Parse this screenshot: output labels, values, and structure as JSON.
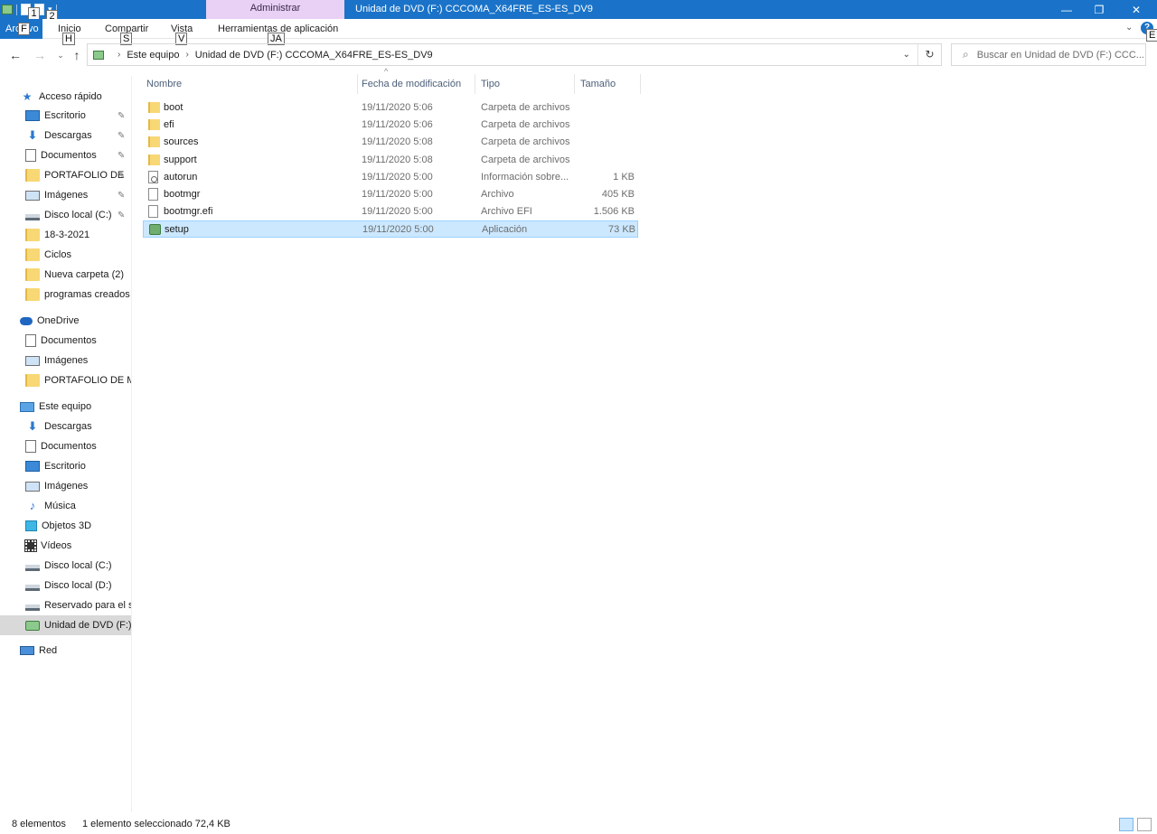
{
  "window": {
    "title": "Unidad de DVD (F:) CCCOMA_X64FRE_ES-ES_DV9",
    "context_tab": "Administrar",
    "controls": {
      "minimize": "—",
      "restore": "❐",
      "close": "✕"
    }
  },
  "quick_access_keytips": [
    "1",
    "2"
  ],
  "ribbon": {
    "tabs": [
      {
        "label": "Archivo",
        "keytip": "F"
      },
      {
        "label": "Inicio",
        "keytip": "H"
      },
      {
        "label": "Compartir",
        "keytip": "S"
      },
      {
        "label": "Vista",
        "keytip": "V"
      },
      {
        "label": "Herramientas de aplicación",
        "keytip": "JA"
      }
    ],
    "help_keytip": "E"
  },
  "address": {
    "crumbs": [
      "Este equipo",
      "Unidad de DVD (F:) CCCOMA_X64FRE_ES-ES_DV9"
    ],
    "search_placeholder": "Buscar en Unidad de DVD (F:) CCC..."
  },
  "nav": {
    "quick_access": {
      "label": "Acceso rápido"
    },
    "quick_items": [
      {
        "label": "Escritorio",
        "icon": "desktop-icon",
        "pinned": true
      },
      {
        "label": "Descargas",
        "icon": "download-icon",
        "pinned": true
      },
      {
        "label": "Documentos",
        "icon": "document-icon",
        "pinned": true
      },
      {
        "label": "PORTAFOLIO DE",
        "icon": "folder-icon",
        "pinned": true
      },
      {
        "label": "Imágenes",
        "icon": "pictures-icon",
        "pinned": true
      },
      {
        "label": "Disco local (C:)",
        "icon": "drive-icon",
        "pinned": true
      },
      {
        "label": "18-3-2021",
        "icon": "folder-icon",
        "pinned": false
      },
      {
        "label": "Ciclos",
        "icon": "folder-icon",
        "pinned": false
      },
      {
        "label": "Nueva carpeta (2)",
        "icon": "folder-icon",
        "pinned": false
      },
      {
        "label": "programas creados",
        "icon": "folder-icon",
        "pinned": false
      }
    ],
    "onedrive": {
      "label": "OneDrive"
    },
    "onedrive_items": [
      {
        "label": "Documentos",
        "icon": "document-icon"
      },
      {
        "label": "Imágenes",
        "icon": "pictures-icon"
      },
      {
        "label": "PORTAFOLIO DE MA",
        "icon": "folder-icon"
      }
    ],
    "this_pc": {
      "label": "Este equipo"
    },
    "pc_items": [
      {
        "label": "Descargas",
        "icon": "download-icon"
      },
      {
        "label": "Documentos",
        "icon": "document-icon"
      },
      {
        "label": "Escritorio",
        "icon": "desktop-icon"
      },
      {
        "label": "Imágenes",
        "icon": "pictures-icon"
      },
      {
        "label": "Música",
        "icon": "music-icon"
      },
      {
        "label": "Objetos 3D",
        "icon": "3d-objects-icon"
      },
      {
        "label": "Vídeos",
        "icon": "video-icon"
      },
      {
        "label": "Disco local (C:)",
        "icon": "drive-icon"
      },
      {
        "label": "Disco local (D:)",
        "icon": "drive-icon"
      },
      {
        "label": "Reservado para el si",
        "icon": "drive-icon"
      },
      {
        "label": "Unidad de DVD (F:)",
        "icon": "dvd-drive-icon",
        "selected": true
      }
    ],
    "network": {
      "label": "Red"
    }
  },
  "filelist": {
    "columns": [
      "Nombre",
      "Fecha de modificación",
      "Tipo",
      "Tamaño"
    ],
    "rows": [
      {
        "name": "boot",
        "date": "19/11/2020 5:06",
        "type": "Carpeta de archivos",
        "size": "",
        "icon": "folder-icon"
      },
      {
        "name": "efi",
        "date": "19/11/2020 5:06",
        "type": "Carpeta de archivos",
        "size": "",
        "icon": "folder-icon"
      },
      {
        "name": "sources",
        "date": "19/11/2020 5:08",
        "type": "Carpeta de archivos",
        "size": "",
        "icon": "folder-icon"
      },
      {
        "name": "support",
        "date": "19/11/2020 5:08",
        "type": "Carpeta de archivos",
        "size": "",
        "icon": "folder-icon"
      },
      {
        "name": "autorun",
        "date": "19/11/2020 5:00",
        "type": "Información sobre...",
        "size": "1 KB",
        "icon": "settings-file-icon"
      },
      {
        "name": "bootmgr",
        "date": "19/11/2020 5:00",
        "type": "Archivo",
        "size": "405 KB",
        "icon": "file-icon"
      },
      {
        "name": "bootmgr.efi",
        "date": "19/11/2020 5:00",
        "type": "Archivo EFI",
        "size": "1.506 KB",
        "icon": "file-icon"
      },
      {
        "name": "setup",
        "date": "19/11/2020 5:00",
        "type": "Aplicación",
        "size": "73 KB",
        "icon": "setup-app-icon",
        "selected": true
      }
    ]
  },
  "status": {
    "count": "8 elementos",
    "selection": "1 elemento seleccionado  72,4 KB"
  }
}
